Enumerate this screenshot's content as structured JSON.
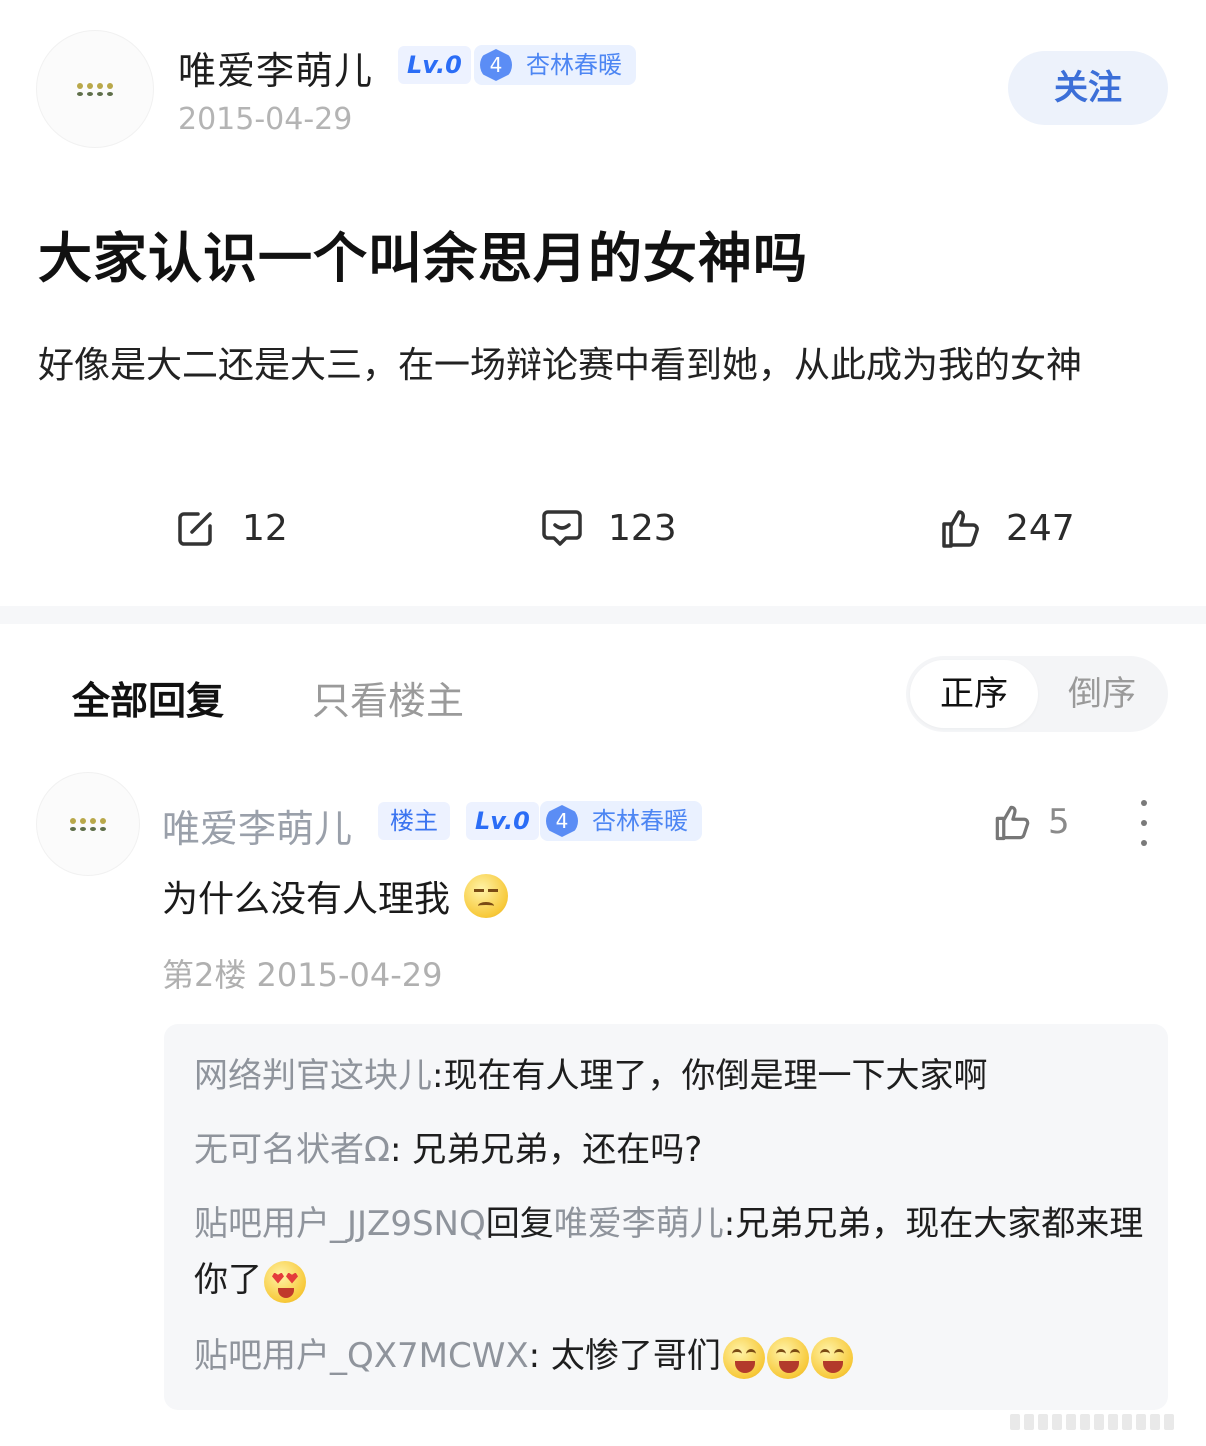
{
  "post": {
    "author": "唯爱李萌儿",
    "level": "Lv.0",
    "bar_level": "4",
    "bar_badge": "杏林春暖",
    "date": "2015-04-29",
    "follow_label": "关注",
    "title": "大家认识一个叫余思月的女神吗",
    "body": "好像是大二还是大三，在一场辩论赛中看到她，从此成为我的女神",
    "share_count": "12",
    "comment_count": "123",
    "like_count": "247"
  },
  "replies": {
    "tab_all": "全部回复",
    "tab_owner_only": "只看楼主",
    "sort_asc": "正序",
    "sort_desc": "倒序"
  },
  "comment": {
    "author": "唯爱李萌儿",
    "owner_badge": "楼主",
    "level": "Lv.0",
    "bar_level": "4",
    "bar_badge": "杏林春暖",
    "like_count": "5",
    "text": "为什么没有人理我",
    "meta": "第2楼 2015-04-29",
    "subreplies": [
      {
        "name": "网络判官这块儿",
        "text": ":现在有人理了，你倒是理一下大家啊"
      },
      {
        "name": "无可名状者Ω",
        "text": ": 兄弟兄弟，还在吗?"
      },
      {
        "name": "贴吧用户_JJZ9SNQ",
        "reply_word": "回复",
        "reply_to": "唯爱李萌儿",
        "text": ":兄弟兄弟，现在大家都来理你了"
      },
      {
        "name": "贴吧用户_QX7MCWX",
        "text": ": 太惨了哥们"
      }
    ]
  },
  "icons": {
    "share": "share-icon",
    "comment": "comment-icon",
    "like": "thumbs-up-icon",
    "more": "more-vertical-icon"
  },
  "colors": {
    "accent_blue": "#3c6fd8",
    "badge_bg": "#edf2ff",
    "muted_text": "#b0b0b0",
    "subreply_bg": "#f6f7f9"
  }
}
